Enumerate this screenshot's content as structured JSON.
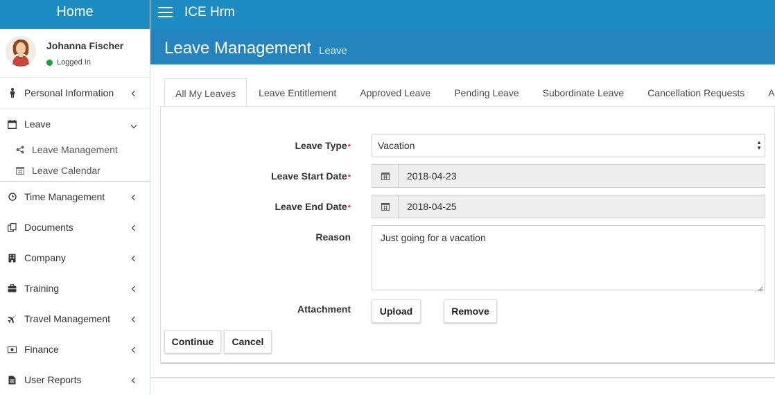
{
  "sidebar": {
    "home_label": "Home",
    "user": {
      "name": "Johanna Fischer",
      "status": "Logged In"
    },
    "items": [
      {
        "label": "Personal Information",
        "icon": "person-icon"
      },
      {
        "label": "Leave",
        "icon": "calendar-icon",
        "expanded": true
      },
      {
        "label": "Time Management",
        "icon": "clock-icon"
      },
      {
        "label": "Documents",
        "icon": "documents-icon"
      },
      {
        "label": "Company",
        "icon": "building-icon"
      },
      {
        "label": "Training",
        "icon": "briefcase-icon"
      },
      {
        "label": "Travel Management",
        "icon": "plane-icon"
      },
      {
        "label": "Finance",
        "icon": "money-icon"
      },
      {
        "label": "User Reports",
        "icon": "file-icon"
      }
    ],
    "leave_sub_items": [
      {
        "label": "Leave Management",
        "icon": "share-icon"
      },
      {
        "label": "Leave Calendar",
        "icon": "calendar-icon"
      }
    ]
  },
  "topbar": {
    "app_title": "ICE Hrm"
  },
  "header": {
    "title": "Leave Management",
    "subtitle": "Leave"
  },
  "tabs": [
    "All My Leaves",
    "Leave Entitlement",
    "Approved Leave",
    "Pending Leave",
    "Subordinate Leave",
    "Cancellation Requests",
    "Ap"
  ],
  "form": {
    "leave_type": {
      "label": "Leave Type",
      "value": "Vacation"
    },
    "start_date": {
      "label": "Leave Start Date",
      "value": "2018-04-23"
    },
    "end_date": {
      "label": "Leave End Date",
      "value": "2018-04-25"
    },
    "reason": {
      "label": "Reason",
      "value": "Just going for a vacation"
    },
    "attachment": {
      "label": "Attachment",
      "upload_label": "Upload",
      "remove_label": "Remove"
    },
    "continue_label": "Continue",
    "cancel_label": "Cancel"
  },
  "colors": {
    "topbar": "#1d8cc3",
    "header": "#2484bd",
    "status_online": "#1f9d3a",
    "required": "#c9302c"
  }
}
